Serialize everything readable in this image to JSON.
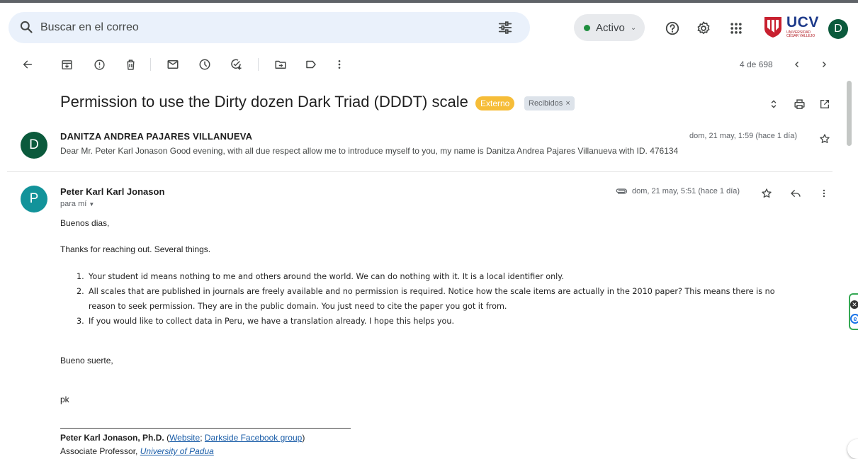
{
  "search": {
    "placeholder": "Buscar en el correo"
  },
  "status": {
    "label": "Activo",
    "color": "#1e8e3e"
  },
  "account": {
    "org_logo_text": "UCV",
    "org_logo_subtext": "UNIVERSIDAD CÉSAR VALLEJO",
    "avatar_letter": "D"
  },
  "toolbar": {
    "pager": "4 de 698",
    "icons": [
      "back-arrow-icon",
      "archive-icon",
      "report-spam-icon",
      "delete-icon",
      "mark-unread-icon",
      "snooze-icon",
      "add-task-icon",
      "move-to-icon",
      "label-icon",
      "more-vert-icon"
    ]
  },
  "thread": {
    "subject": "Permission to use the Dirty dozen Dark Triad (DDDT) scale",
    "labels": {
      "external": "Externo",
      "external_color": "#f6bd38",
      "inbox": "Recibidos",
      "inbox_remove": "×"
    }
  },
  "messages": [
    {
      "avatar_letter": "D",
      "avatar_color": "#0b5a3c",
      "sender": "DANITZA ANDREA PAJARES VILLANUEVA",
      "date": "dom, 21 may, 1:59 (hace 1 día)",
      "snippet": "Dear Mr. Peter Karl Jonason Good evening, with all due respect allow me to introduce myself to you, my name is Danitza Andrea Pajares Villanueva with ID. 476134"
    },
    {
      "avatar_letter": "P",
      "avatar_color": "#12939a",
      "sender": "Peter Karl Karl Jonason",
      "recipient": "para mí",
      "date": "dom, 21 may, 5:51 (hace 1 día)",
      "greeting": "Buenos dias,",
      "intro": "Thanks for reaching out. Several things.",
      "points": [
        {
          "num": "1.",
          "lines": [
            "Your student id means nothing to me and others around the world. We can do nothing with it. It is a local identifier only."
          ]
        },
        {
          "num": "2.",
          "lines": [
            "All scales that are published in journals are freely available and no permission is required. Notice how the scale items are actually in the 2010 paper? This means there is no",
            "reason to seek permission. They are in the public domain. You just need to cite the paper you got it from."
          ]
        },
        {
          "num": "3.",
          "lines": [
            "If you would like to collect data in Peru, we have a translation already. I hope this helps you."
          ]
        }
      ],
      "closing": "Bueno suerte,",
      "initials": "pk",
      "signature": {
        "name": "Peter Karl Jonason, Ph.D.",
        "open_paren": "(",
        "website_link": "Website",
        "separator": ";",
        "facebook_link": "Darkside Facebook group",
        "close_paren": ")",
        "role": "Associate Professor,",
        "university_link": "University of Padua"
      }
    }
  ]
}
